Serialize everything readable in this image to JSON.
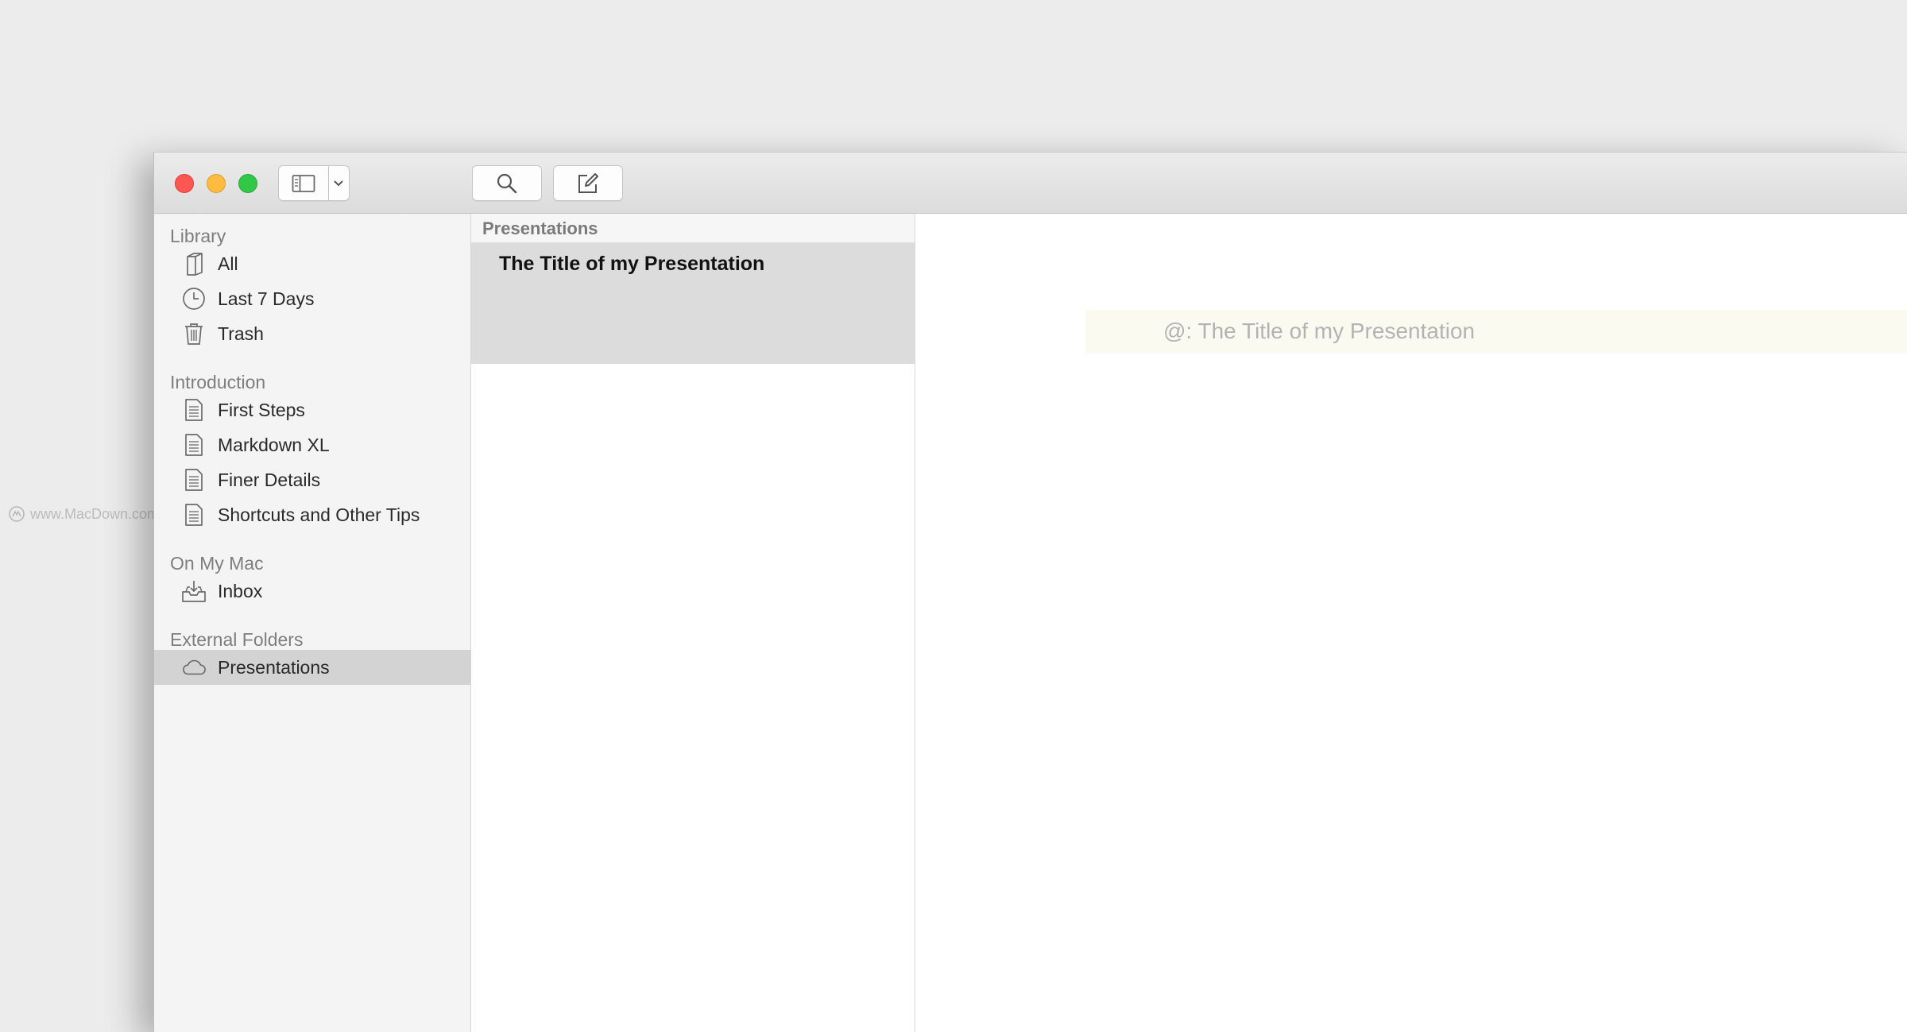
{
  "watermark": "www.MacDown.com",
  "toolbar": {
    "sidebar_toggle_icon": "sidebar-icon",
    "dropdown_icon": "chevron-down-icon",
    "search_icon": "search-icon",
    "compose_icon": "compose-icon"
  },
  "sidebar": {
    "sections": [
      {
        "title": "Library",
        "items": [
          {
            "label": "All",
            "icon": "book-icon"
          },
          {
            "label": "Last 7 Days",
            "icon": "clock-icon"
          },
          {
            "label": "Trash",
            "icon": "trash-icon"
          }
        ]
      },
      {
        "title": "Introduction",
        "items": [
          {
            "label": "First Steps",
            "icon": "document-icon"
          },
          {
            "label": "Markdown XL",
            "icon": "document-icon"
          },
          {
            "label": "Finer Details",
            "icon": "document-icon"
          },
          {
            "label": "Shortcuts and Other Tips",
            "icon": "document-icon"
          }
        ]
      },
      {
        "title": "On My Mac",
        "items": [
          {
            "label": "Inbox",
            "icon": "inbox-icon"
          }
        ]
      },
      {
        "title": "External Folders",
        "items": [
          {
            "label": "Presentations",
            "icon": "cloud-icon",
            "selected": true
          }
        ]
      }
    ]
  },
  "notelist": {
    "header": "Presentations",
    "notes": [
      {
        "title": "The Title of my Presentation",
        "selected": true
      }
    ]
  },
  "editor": {
    "first_line": "@: The Title of my Presentation",
    "line_highlight_color": "#fbfaf1"
  }
}
